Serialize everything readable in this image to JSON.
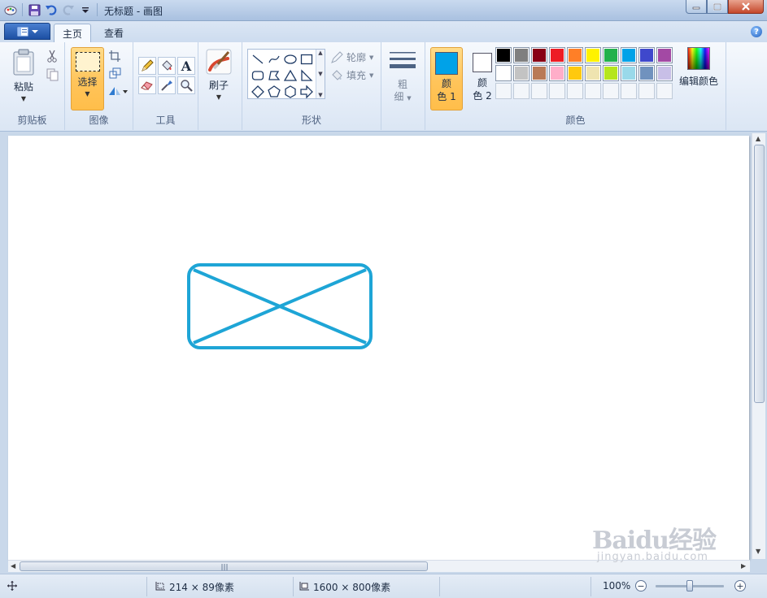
{
  "window": {
    "title": "无标题 - 画图"
  },
  "tabs": [
    {
      "label": "主页",
      "active": true
    },
    {
      "label": "查看",
      "active": false
    }
  ],
  "ribbon": {
    "clipboard": {
      "label": "剪贴板",
      "paste_label": "粘贴"
    },
    "image": {
      "label": "图像",
      "select_label": "选择"
    },
    "tools": {
      "label": "工具",
      "text_glyph": "A"
    },
    "brushes": {
      "label": "刷子"
    },
    "shapes": {
      "label": "形状",
      "outline_label": "轮廓",
      "fill_label": "填充"
    },
    "size": {
      "label_line1": "粗",
      "label_line2": "细"
    },
    "colors": {
      "label": "颜色",
      "color1_line1": "颜",
      "color1_line2": "色 1",
      "color2_line1": "颜",
      "color2_line2": "色 2",
      "edit_label": "编辑颜色",
      "color1_value": "#00a2e8",
      "color2_value": "#ffffff",
      "palette": [
        "#000000",
        "#7f7f7f",
        "#880015",
        "#ed1c24",
        "#ff7f27",
        "#fff200",
        "#22b14c",
        "#00a2e8",
        "#3f48cc",
        "#a349a4",
        "#ffffff",
        "#c3c3c3",
        "#b97a57",
        "#ffaec9",
        "#ffc90e",
        "#efe4b0",
        "#b5e61d",
        "#99d9ea",
        "#7092be",
        "#c8bfe7",
        "",
        "",
        "",
        "",
        "",
        "",
        "",
        "",
        "",
        ""
      ]
    }
  },
  "canvas": {
    "stroke_color": "#1ea5d6"
  },
  "status": {
    "selection_size": "214 × 89像素",
    "canvas_size": "1600 × 800像素",
    "zoom": "100%"
  },
  "watermark": {
    "main": "Baidu经验",
    "sub": "jingyan.baidu.com"
  }
}
